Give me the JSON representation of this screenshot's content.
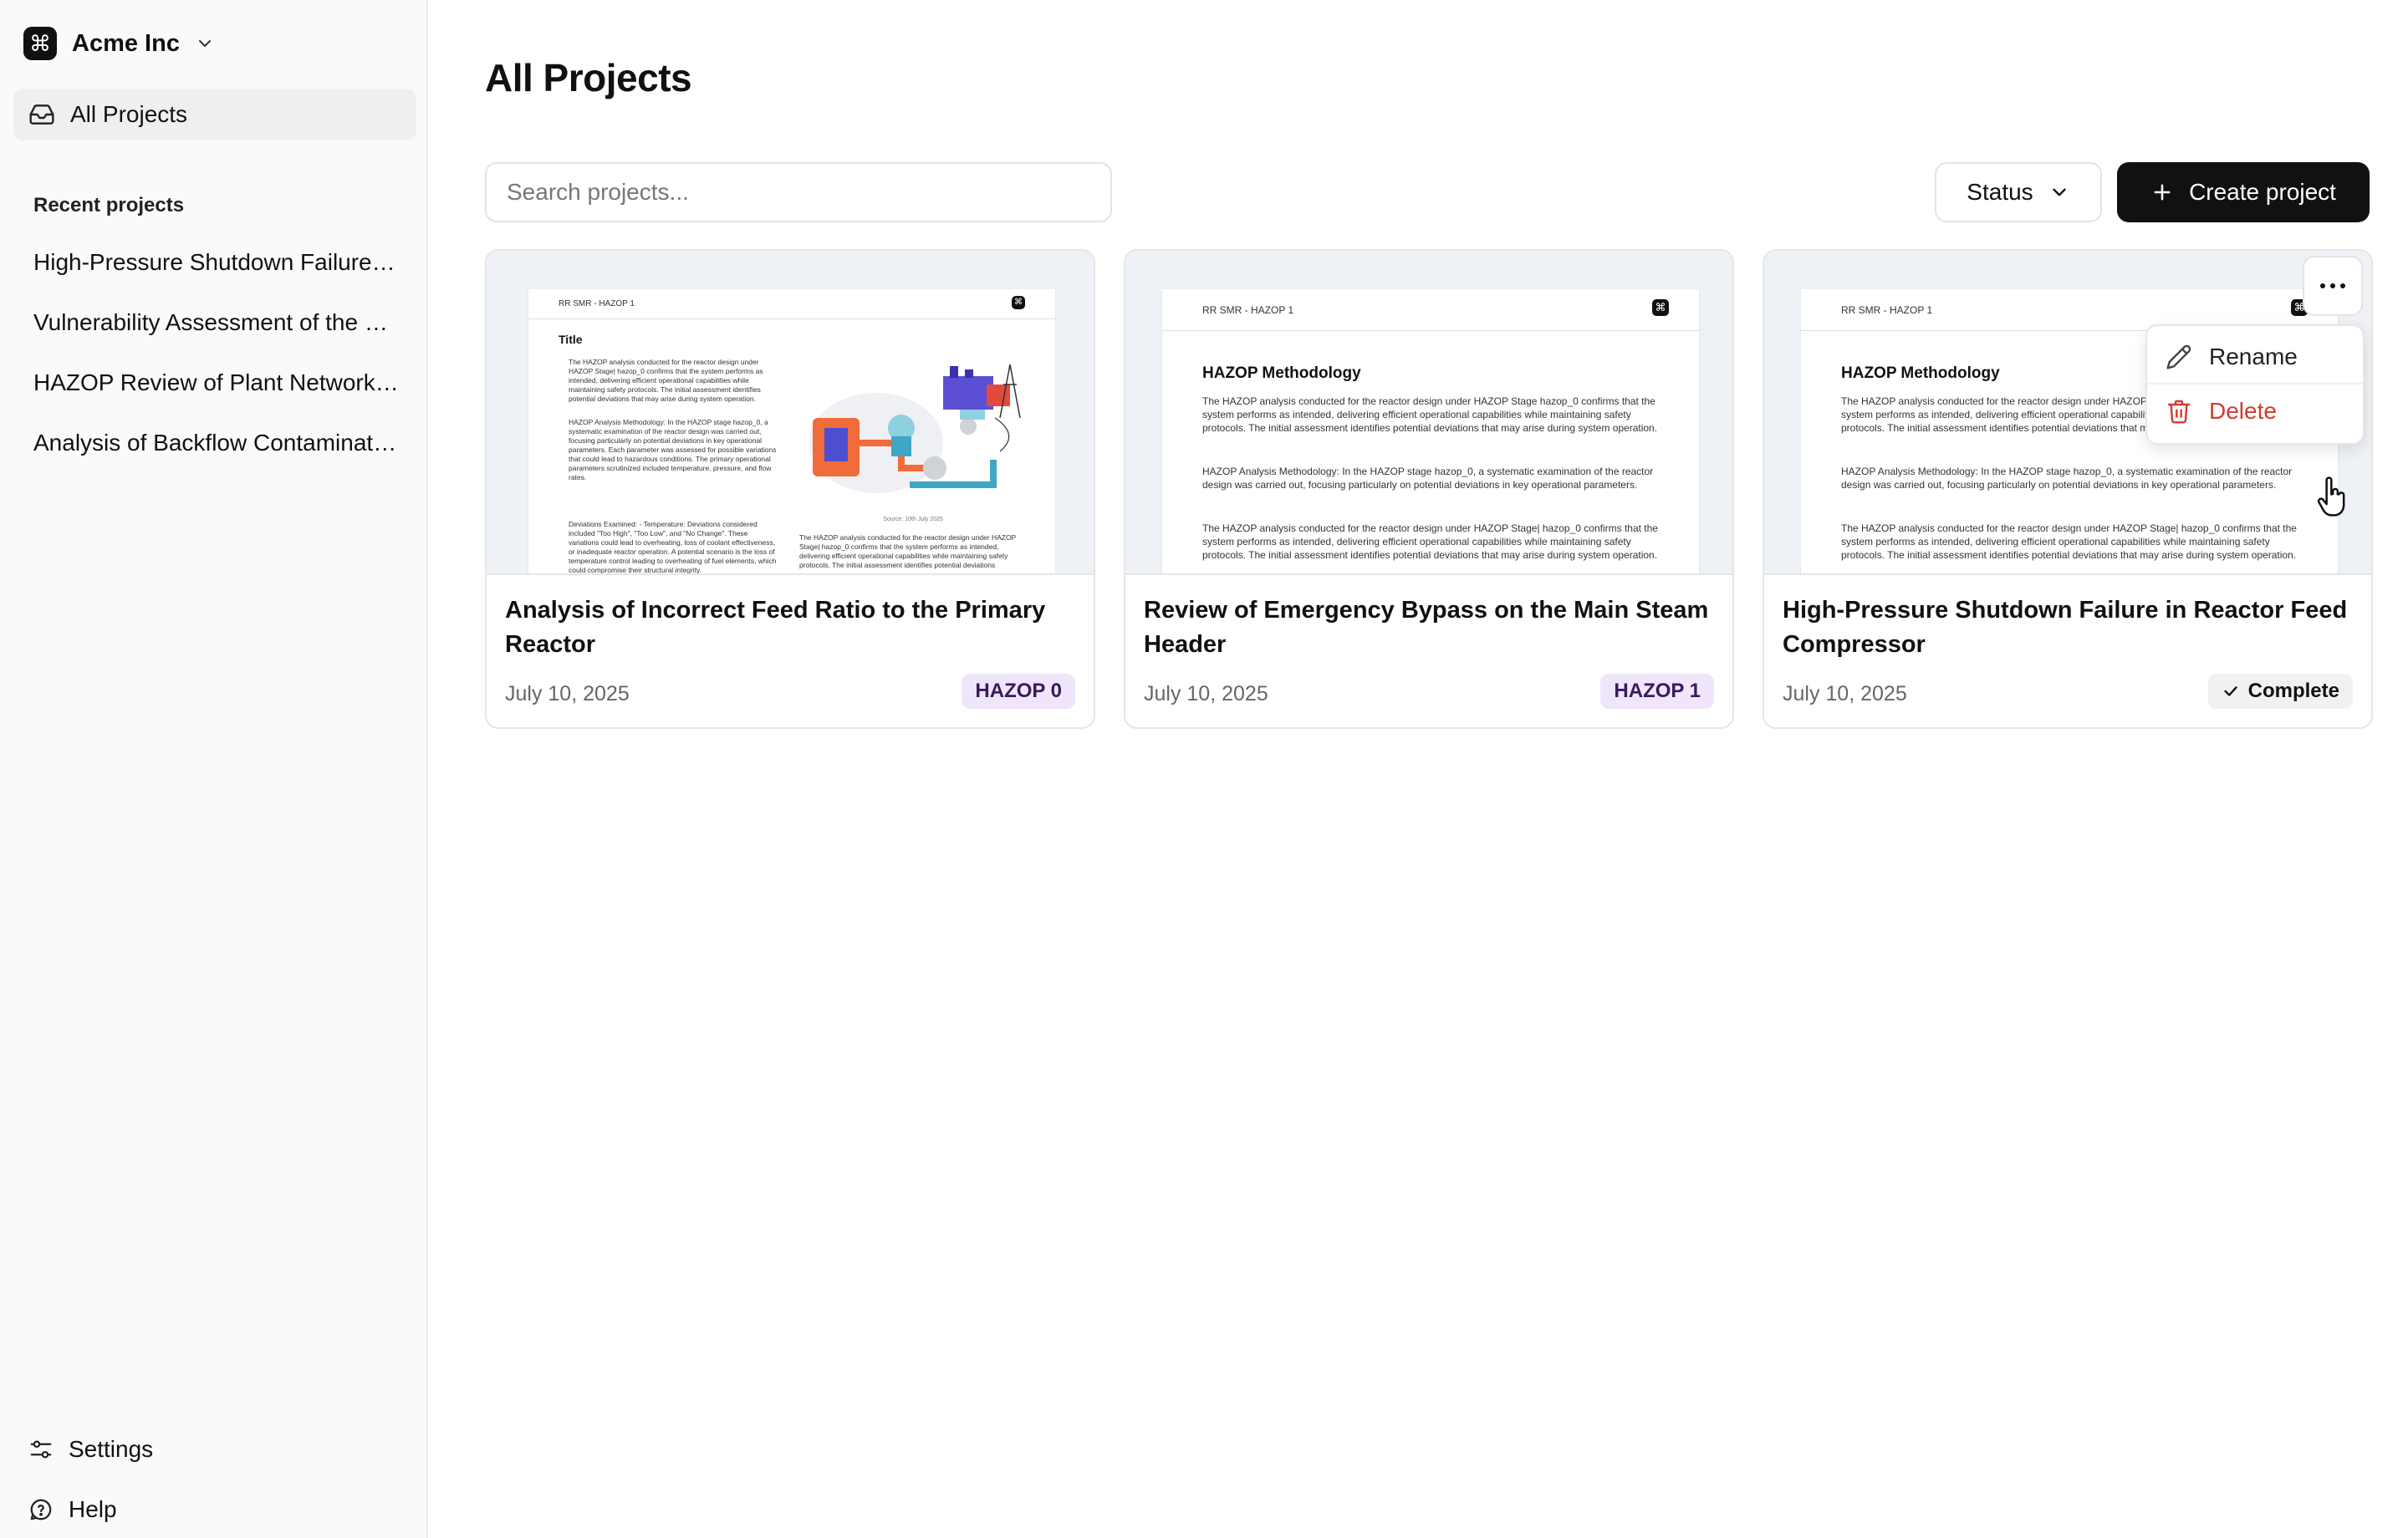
{
  "org": {
    "name": "Acme Inc",
    "logo_glyph": "⌘"
  },
  "sidebar": {
    "all_projects_label": "All Projects",
    "recent_title": "Recent projects",
    "recent": [
      "High-Pressure Shutdown Failure in Reactor Feed Compressor",
      "Vulnerability Assessment of the Plant Network",
      "HAZOP Review of Plant Network Infrastructure",
      "Analysis of Backflow Contamination in Water Lines"
    ],
    "settings_label": "Settings",
    "help_label": "Help"
  },
  "main": {
    "title": "All Projects",
    "search_placeholder": "Search projects...",
    "status_label": "Status",
    "create_label": "Create project"
  },
  "projects": [
    {
      "title": "Analysis of Incorrect Feed Ratio to the Primary Reactor",
      "date": "July 10, 2025",
      "badge": "HAZOP 0",
      "thumb": {
        "header": "RR SMR - HAZOP 1",
        "heading": "Title",
        "para1": "The HAZOP analysis conducted for the reactor design under HAZOP Stage| hazop_0 confirms that the system performs as intended, delivering efficient operational capabilities while maintaining safety protocols. The initial assessment identifies potential deviations that may arise during system operation.",
        "para2": "HAZOP Analysis Methodology: In the HAZOP stage hazop_0, a systematic examination of the reactor design was carried out, focusing particularly on potential deviations in key operational parameters. Each parameter was assessed for possible variations that could lead to hazardous conditions. The primary operational parameters scrutinized included temperature, pressure, and flow rates.",
        "para3": "Deviations Examined: - Temperature: Deviations considered included \"Too High\", \"Too Low\", and \"No Change\". These variations could lead to overheating, loss of coolant effectiveness, or inadequate reactor operation. A potential scenario is the loss of temperature control leading to overheating of fuel elements, which could compromise their structural integrity.",
        "caption": "Source: 10th July 2025",
        "para4": "The HAZOP analysis conducted for the reactor design under HAZOP Stage| hazop_0 confirms that the system performs as intended, delivering efficient operational capabilities while maintaining safety protocols. The initial assessment identifies potential deviations"
      }
    },
    {
      "title": "Review of Emergency Bypass on the Main Steam Header",
      "date": "July 10, 2025",
      "badge": "HAZOP 1",
      "thumb": {
        "header": "RR SMR - HAZOP 1",
        "heading": "HAZOP Methodology",
        "para1": "The HAZOP analysis conducted for the reactor design under HAZOP Stage hazop_0 confirms that the system performs as intended, delivering efficient operational capabilities while maintaining safety protocols. The initial assessment identifies potential deviations that may arise during system operation.",
        "para2": "HAZOP Analysis Methodology: In the HAZOP stage hazop_0, a systematic examination of the reactor design was carried out, focusing particularly on potential deviations in key operational parameters.",
        "para3": "The HAZOP analysis conducted for the reactor design under HAZOP Stage| hazop_0 confirms that the system performs as intended, delivering efficient operational capabilities while maintaining safety protocols. The initial assessment identifies potential deviations that may arise during system operation."
      }
    },
    {
      "title": "High-Pressure Shutdown Failure in Reactor Feed Compressor",
      "date": "July 10, 2025",
      "badge": "Complete",
      "thumb": {
        "header": "RR SMR - HAZOP 1",
        "heading": "HAZOP Methodology",
        "para1": "The HAZOP analysis conducted for the reactor design under HAZOP Stage hazop_0 confirms that the system performs as intended, delivering efficient operational capabilities while maintaining safety protocols. The initial assessment identifies potential deviations that may arise during system operation.",
        "para2": "HAZOP Analysis Methodology: In the HAZOP stage hazop_0, a systematic examination of the reactor design was carried out, focusing particularly on potential deviations in key operational parameters.",
        "para3": "The HAZOP analysis conducted for the reactor design under HAZOP Stage| hazop_0 confirms that the system performs as intended, delivering efficient operational capabilities while maintaining safety protocols. The initial assessment identifies potential deviations that may arise during system operation."
      }
    }
  ],
  "menu": {
    "rename_label": "Rename",
    "delete_label": "Delete"
  },
  "colors": {
    "accent": "#111111",
    "badge_hazop_bg": "#efe6fb",
    "badge_hazop_text": "#3a1a5c",
    "delete": "#d33a2c",
    "sidebar_bg": "#fafafa"
  },
  "icons": [
    "command-icon",
    "chevron-down-icon",
    "inbox-icon",
    "sliders-icon",
    "help-circle-icon",
    "plus-icon",
    "check-icon",
    "more-horizontal-icon",
    "pencil-icon",
    "trash-icon",
    "hand-pointer-icon"
  ]
}
